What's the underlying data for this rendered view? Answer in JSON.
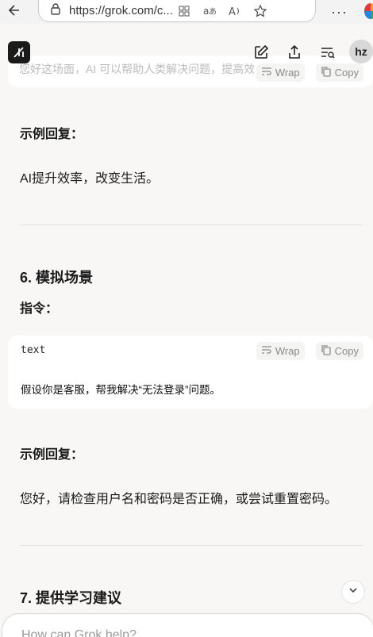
{
  "browser": {
    "url": "https://grok.com/c...",
    "menu": "···"
  },
  "header": {
    "avatar_initials": "hz"
  },
  "top_code": {
    "faded_text": "您好这场面，AI 可以帮助人类解决问题，提高效",
    "wrap_label": "Wrap",
    "copy_label": "Copy"
  },
  "content": {
    "example_reply_label_1": "示例回复：",
    "example_reply_1": "AI提升效率，改变生活。",
    "section6_title": "6. 模拟场景",
    "instruction_label": "指令：",
    "code_lang": "text",
    "code_wrap": "Wrap",
    "code_copy": "Copy",
    "code_content": "假设你是客服，帮我解决“无法登录”问题。",
    "example_reply_label_2": "示例回复：",
    "example_reply_2": "您好，请检查用户名和密码是否正确，或尝试重置密码。",
    "section7_title": "7. 提供学习建议"
  },
  "input": {
    "placeholder": "How can Grok help?"
  }
}
